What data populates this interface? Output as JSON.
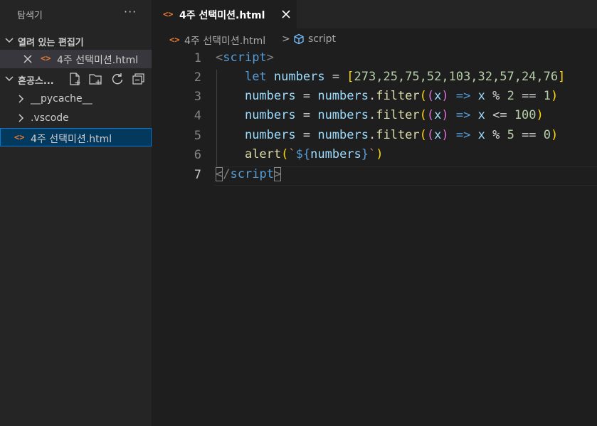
{
  "explorer": {
    "title": "탐색기",
    "more": "···",
    "open_editors_label": "열려 있는 편집기",
    "open_editor_icon": "<>",
    "open_editor_file": "4주 선택미션.html",
    "workspace_label": "혼공스...",
    "tree": [
      {
        "label": "__pycache__",
        "type": "folder"
      },
      {
        "label": ".vscode",
        "type": "folder"
      },
      {
        "label": "4주 선택미션.html",
        "type": "file",
        "icon": "<>"
      }
    ]
  },
  "tab": {
    "icon": "<>",
    "label": "4주 선택미션.html"
  },
  "breadcrumb": {
    "file_icon": "<>",
    "file": "4주 선택미션.html",
    "separator": ">",
    "symbol": "script"
  },
  "editor": {
    "current_line": 7,
    "lines": [
      {
        "num": "1"
      },
      {
        "num": "2"
      },
      {
        "num": "3"
      },
      {
        "num": "4"
      },
      {
        "num": "5"
      },
      {
        "num": "6"
      },
      {
        "num": "7"
      }
    ],
    "code": {
      "l1_open": "<",
      "l1_tag": "script",
      "l1_close": ">",
      "l2_kw": "let",
      "l2_var": "numbers",
      "l2_eq": " = ",
      "l2_arr_open": "[",
      "l2_arr": "273,25,75,52,103,32,57,24,76",
      "l2_arr_close": "]",
      "l3_a": "numbers",
      "l3_eq": " = ",
      "l3_b": "numbers",
      "l3_dot": ".",
      "l3_fn": "filter",
      "l3_po": "(",
      "l3_pi": "(",
      "l3_x": "x",
      "l3_pc": ")",
      "l3_arrow": " => ",
      "l3_x2": "x",
      "l3_op": " % ",
      "l3_n1": "2",
      "l3_eqq": " == ",
      "l3_n2": "1",
      "l3_end": ")",
      "l4_a": "numbers",
      "l4_eq": " = ",
      "l4_b": "numbers",
      "l4_dot": ".",
      "l4_fn": "filter",
      "l4_po": "(",
      "l4_pi": "(",
      "l4_x": "x",
      "l4_pc": ")",
      "l4_arrow": " => ",
      "l4_x2": "x",
      "l4_op": " <= ",
      "l4_n1": "100",
      "l4_end": ")",
      "l5_a": "numbers",
      "l5_eq": " = ",
      "l5_b": "numbers",
      "l5_dot": ".",
      "l5_fn": "filter",
      "l5_po": "(",
      "l5_pi": "(",
      "l5_x": "x",
      "l5_pc": ")",
      "l5_arrow": " => ",
      "l5_x2": "x",
      "l5_op": " % ",
      "l5_n1": "5",
      "l5_eqq": " == ",
      "l5_n2": "0",
      "l5_end": ")",
      "l6_fn": "alert",
      "l6_po": "(",
      "l6_bt": "`",
      "l6_do": "${",
      "l6_var": "numbers",
      "l6_dc": "}",
      "l6_bt2": "`",
      "l6_end": ")",
      "l7_open": "<",
      "l7_slash": "/",
      "l7_tag": "script",
      "l7_close": ">"
    }
  },
  "colors": {
    "accent": "#0078d4",
    "html_icon": "#e37933",
    "selection": "#04395e"
  }
}
